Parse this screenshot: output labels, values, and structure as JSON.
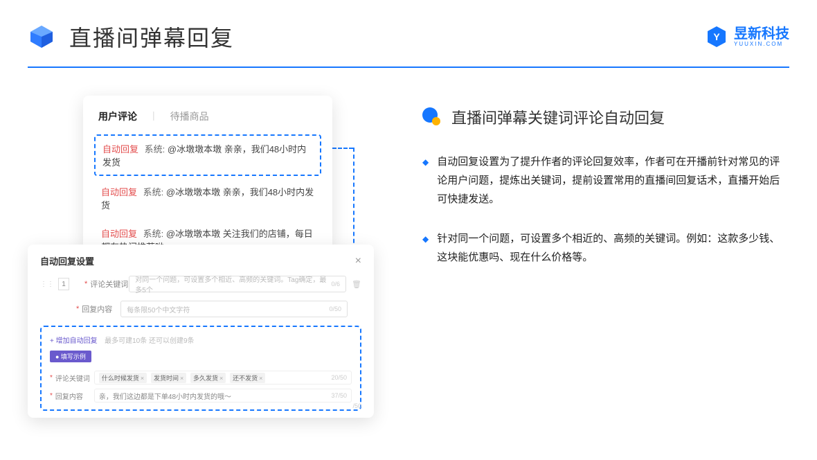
{
  "header": {
    "title": "直播间弹幕回复",
    "brand_name": "昱新科技",
    "brand_sub": "YUUXIN.COM"
  },
  "right": {
    "section_title": "直播间弹幕关键词评论自动回复",
    "bullet1": "自动回复设置为了提升作者的评论回复效率，作者可在开播前针对常见的评论用户问题，提炼出关键词，提前设置常用的直播间回复话术，直播开始后可快捷发送。",
    "bullet2": "针对同一个问题，可设置多个相近的、高频的关键词。例如：这款多少钱、这块能优惠吗、现在什么价格等。"
  },
  "card1": {
    "tab_active": "用户评论",
    "tab_other": "待播商品",
    "auto_tag": "自动回复",
    "system_label": "系统:",
    "row1_msg": "@冰墩墩本墩 亲亲，我们48小时内发货",
    "row2_msg": "@冰墩墩本墩 亲亲，我们48小时内发货",
    "row3_msg": "@冰墩墩本墩 关注我们的店铺，每日都有热门推荐呦～"
  },
  "card2": {
    "title": "自动回复设置",
    "row_index": "1",
    "keyword_label": "评论关键词",
    "keyword_placeholder": "对同一个问题，可设置多个相近、高频的关键词。Tag确定，最多5个",
    "keyword_count": "0/6",
    "reply_label": "回复内容",
    "reply_placeholder": "每条限50个中文字符",
    "reply_count": "0/50",
    "add_link": "+ 增加自动回复",
    "add_hint": "最多可建10条 还可以创建9条",
    "badge": "● 填写示例",
    "ex_keyword_label": "评论关键词",
    "tokens": [
      "什么时候发货",
      "发货时间",
      "多久发货",
      "还不发货"
    ],
    "ex_keyword_count": "20/50",
    "ex_reply_label": "回复内容",
    "ex_reply_value": "亲，我们这边都是下单48小时内发货的哦～",
    "ex_reply_count": "37/50",
    "outside_count": "/50"
  }
}
